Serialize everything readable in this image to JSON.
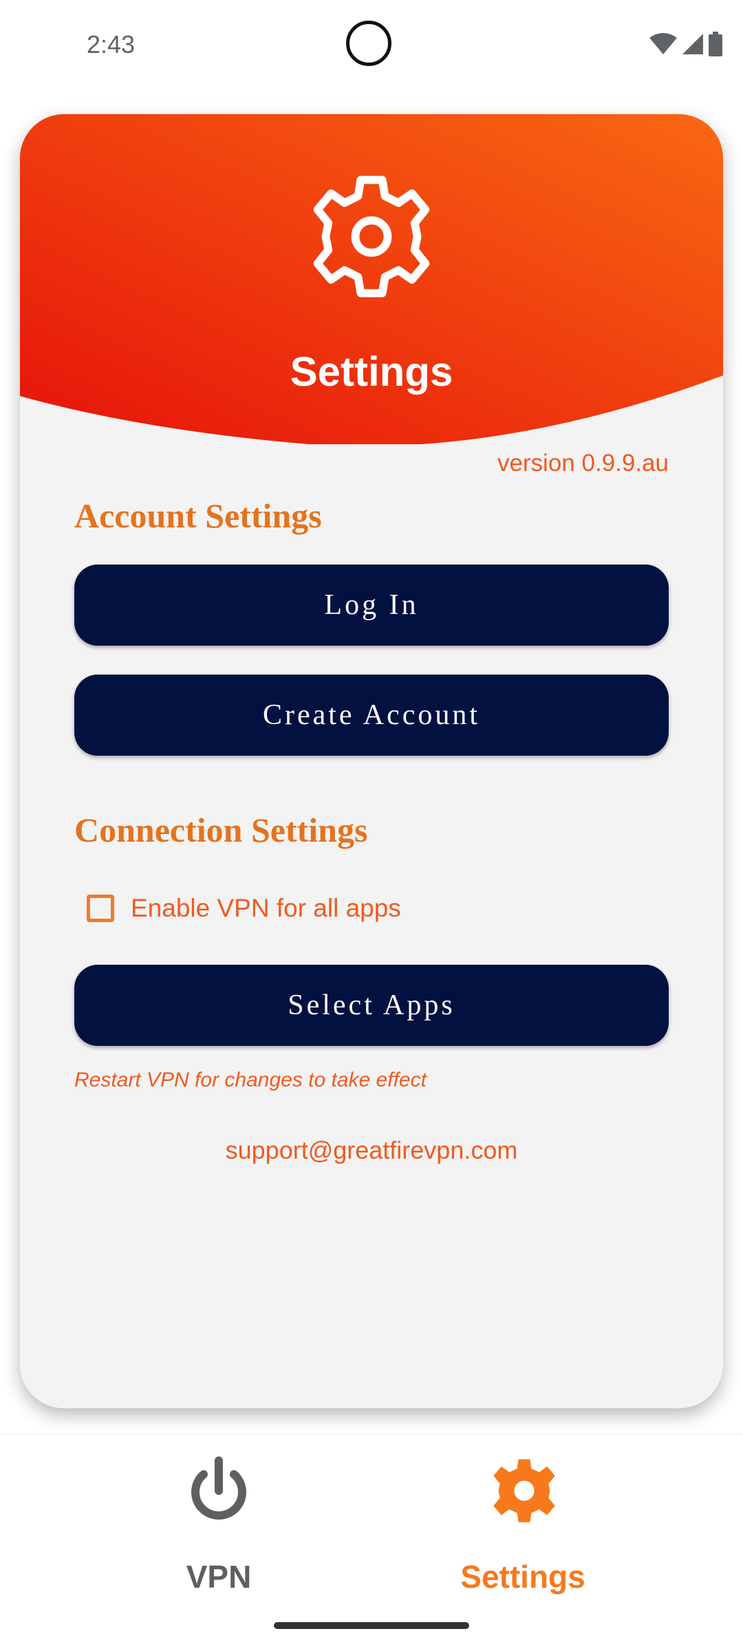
{
  "status_bar": {
    "time": "2:43",
    "icons": [
      "wifi-icon",
      "cellular-signal-icon",
      "battery-icon"
    ]
  },
  "header": {
    "title": "Settings",
    "icon": "gear-icon",
    "gradient_colors": [
      "#e6120a",
      "#f96812"
    ]
  },
  "version": "version 0.9.9.au",
  "account_settings": {
    "title": "Account Settings",
    "login_label": "Log In",
    "create_account_label": "Create Account"
  },
  "connection_settings": {
    "title": "Connection Settings",
    "enable_vpn_label": "Enable VPN for all apps",
    "enable_vpn_checked": false,
    "select_apps_label": "Select Apps",
    "restart_note": "Restart VPN for changes to take effect"
  },
  "support_email": "support@greatfirevpn.com",
  "bottom_nav": {
    "items": [
      {
        "label": "VPN",
        "icon": "power-icon",
        "active": false
      },
      {
        "label": "Settings",
        "icon": "gear-icon",
        "active": true
      }
    ]
  },
  "colors": {
    "accent_orange": "#f15a1f",
    "section_orange": "#e4731f",
    "button_navy": "#021140",
    "nav_active": "#f7791c",
    "nav_inactive": "#5f5f5f"
  }
}
